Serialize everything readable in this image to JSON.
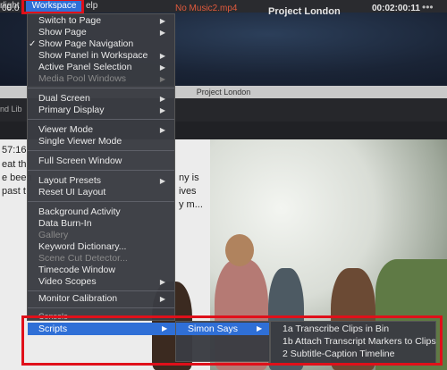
{
  "menubar": {
    "left_partial": "rlight",
    "workspace": "Workspace",
    "help_partial": "elp"
  },
  "window": {
    "title": "Project London",
    "app_title": "Project London",
    "left_partial": "nd Lib"
  },
  "viewer": {
    "left_timecode": "00:0",
    "clip_name": "No Music2.mp4",
    "timecode": "00:02:00:11"
  },
  "transcript": {
    "timecode": "57:16",
    "lines": [
      "eat thi",
      "e been",
      "past t"
    ],
    "right_lines": [
      "ny is",
      "ives",
      "y m..."
    ]
  },
  "workspace_menu": {
    "items": [
      {
        "label": "Switch to Page",
        "submenu": true
      },
      {
        "label": "Show Page",
        "submenu": true
      },
      {
        "label": "Show Page Navigation",
        "checked": true
      },
      {
        "label": "Show Panel in Workspace",
        "submenu": true
      },
      {
        "label": "Active Panel Selection",
        "submenu": true
      },
      {
        "label": "Media Pool Windows",
        "submenu": true,
        "disabled": true
      },
      {
        "label": "Dual Screen",
        "submenu": true
      },
      {
        "label": "Primary Display",
        "submenu": true
      },
      {
        "label": "Viewer Mode",
        "submenu": true
      },
      {
        "label": "Single Viewer Mode"
      },
      {
        "label": "Full Screen Window"
      },
      {
        "label": "Layout Presets",
        "submenu": true
      },
      {
        "label": "Reset UI Layout"
      },
      {
        "label": "Background Activity"
      },
      {
        "label": "Data Burn-In"
      },
      {
        "label": "Gallery",
        "disabled": true
      },
      {
        "label": "Keyword Dictionary..."
      },
      {
        "label": "Scene Cut Detector...",
        "disabled": true
      },
      {
        "label": "Timecode Window"
      },
      {
        "label": "Video Scopes",
        "submenu": true
      },
      {
        "label": "Monitor Calibration",
        "submenu": true
      }
    ],
    "partial_item": "Console",
    "scripts": "Scripts"
  },
  "scripts_submenu": {
    "simon_says": "Simon Says"
  },
  "simon_says_submenu": {
    "items": [
      "1a Transcribe Clips in Bin",
      "1b Attach Transcript Markers to Clips",
      "2 Subtitle-Caption Timeline"
    ]
  },
  "colors": {
    "highlight": "#2f6fd6",
    "annotation": "#e0101a",
    "clip_name": "#e05a3d"
  }
}
